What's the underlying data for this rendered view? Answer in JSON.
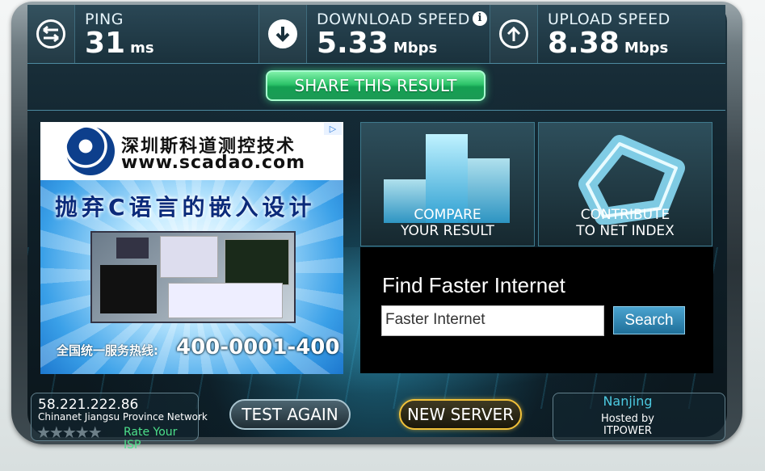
{
  "metrics": {
    "ping": {
      "label": "PING",
      "value": "31",
      "unit": "ms"
    },
    "download": {
      "label": "DOWNLOAD SPEED",
      "value": "5.33",
      "unit": "Mbps",
      "info": "i"
    },
    "upload": {
      "label": "UPLOAD SPEED",
      "value": "8.38",
      "unit": "Mbps"
    }
  },
  "share_label": "SHARE THIS RESULT",
  "ad": {
    "company": "深圳斯科道测控技术",
    "url": "www.scadao.com",
    "headline": "抛弃C语言的嵌入设计",
    "hotline_label": "全国统一服务热线:",
    "hotline": "400-0001-400",
    "adchoice": "▷"
  },
  "tiles": {
    "compare": {
      "line1": "COMPARE",
      "line2": "YOUR RESULT"
    },
    "contribute": {
      "line1": "CONTRIBUTE",
      "line2": "TO NET INDEX"
    }
  },
  "finder": {
    "title": "Find Faster Internet",
    "input_value": "Faster Internet",
    "search_label": "Search"
  },
  "connection": {
    "ip": "58.221.222.86",
    "isp": "Chinanet Jiangsu Province Network",
    "stars": "★★★★★",
    "rate_label": "Rate Your ISP"
  },
  "buttons": {
    "test_again": "TEST AGAIN",
    "new_server": "NEW SERVER"
  },
  "server": {
    "city": "Nanjing",
    "hosted_by": "Hosted by",
    "host": "ITPOWER"
  },
  "colors": {
    "accent_green": "#2dc46a",
    "accent_gold": "#f2c23a",
    "cyan": "#4cc9e0"
  }
}
